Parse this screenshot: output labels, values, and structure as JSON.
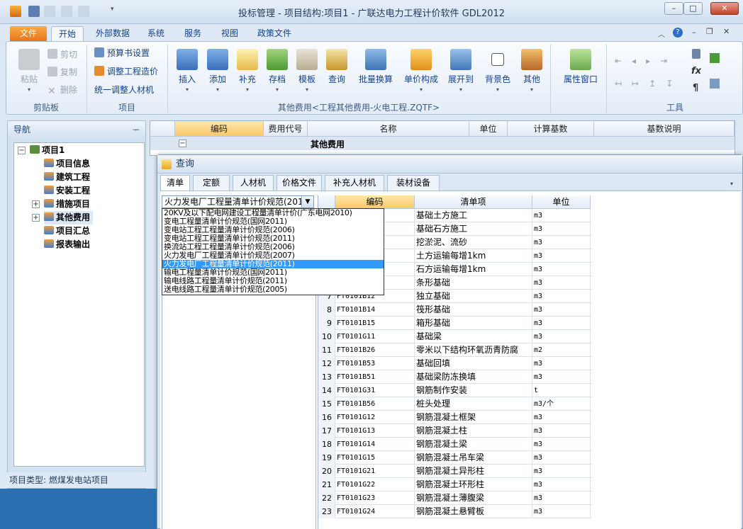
{
  "window": {
    "title": "投标管理 - 项目结构:项目1 - 广联达电力工程计价软件 GDL2012"
  },
  "menu": {
    "tabs": [
      "文件",
      "开始",
      "外部数据",
      "系统",
      "服务",
      "视图",
      "政策文件"
    ]
  },
  "ribbon": {
    "clipboard": {
      "label": "剪贴板",
      "paste": "粘贴",
      "cut": "剪切",
      "copy": "复制",
      "delete": "删除"
    },
    "project": {
      "label": "项目",
      "budget_settings": "预算书设置",
      "adjust_cost": "调整工程造价",
      "adjust_materials": "统一调整人材机"
    },
    "other_costs": {
      "label": "其他费用<工程其他费用-火电工程.ZQTF>",
      "buttons": [
        "插入",
        "添加",
        "补充",
        "存档",
        "模板",
        "查询",
        "批量换算",
        "单价构成",
        "展开到",
        "背景色",
        "其他"
      ]
    },
    "attr": {
      "window": "属性窗口"
    },
    "tools": {
      "label": "工具"
    }
  },
  "nav": {
    "title": "导航",
    "root": "项目1",
    "items": [
      "项目信息",
      "建筑工程",
      "安装工程",
      "措施项目",
      "其他费用",
      "项目汇总",
      "报表输出"
    ],
    "status": "项目类型: 燃煤发电站项目"
  },
  "main_grid": {
    "columns": [
      "编码",
      "费用代号",
      "名称",
      "单位",
      "计算基数",
      "基数说明"
    ],
    "first_row_name": "其他费用"
  },
  "query": {
    "title": "查询",
    "tabs": [
      "清单",
      "定额",
      "人材机",
      "价格文件",
      "补充人材机",
      "装材设备"
    ],
    "selected_standard": "火力发电厂工程量清单计价规范(201",
    "dropdown_options": [
      "20KV及以下配电网建设工程量清单计价(广东电网2010)",
      "变电工程量清单计价规范(国网2011)",
      "变电站工程工程量清单计价规范(2006)",
      "变电站工程工程量清单计价规范(2011)",
      "换流站工程工程量清单计价规范(2006)",
      "火力发电厂工程量清单计价规范(2007)",
      "火力发电厂工程量清单计价规范(2011)",
      "输电工程量清单计价规范(国网2011)",
      "输电线路工程量清单计价规范(2011)",
      "送电线路工程量清单计价规范(2005)"
    ],
    "highlighted_option": 6,
    "columns": [
      "编码",
      "清单项",
      "单位"
    ],
    "rows": [
      {
        "no": "",
        "code": "",
        "name": "基础土方施工",
        "unit": "m3"
      },
      {
        "no": "",
        "code": "",
        "name": "基础石方施工",
        "unit": "m3"
      },
      {
        "no": "",
        "code": "",
        "name": "挖淤泥、流砂",
        "unit": "m3"
      },
      {
        "no": "",
        "code": "",
        "name": "土方运输每增1km",
        "unit": "m3"
      },
      {
        "no": "",
        "code": "",
        "name": "石方运输每增1km",
        "unit": "m3"
      },
      {
        "no": "",
        "code": "",
        "name": "条形基础",
        "unit": "m3"
      },
      {
        "no": "7",
        "code": "FT0101B12",
        "name": "独立基础",
        "unit": "m3"
      },
      {
        "no": "8",
        "code": "FT0101B14",
        "name": "筏形基础",
        "unit": "m3"
      },
      {
        "no": "9",
        "code": "FT0101B15",
        "name": "箱形基础",
        "unit": "m3"
      },
      {
        "no": "10",
        "code": "FT0101G11",
        "name": "基础梁",
        "unit": "m3"
      },
      {
        "no": "11",
        "code": "FT0101B26",
        "name": "零米以下结构环氧沥青防腐",
        "unit": "m2"
      },
      {
        "no": "12",
        "code": "FT0101B53",
        "name": "基础回填",
        "unit": "m3"
      },
      {
        "no": "13",
        "code": "FT0101B51",
        "name": "基础梁防冻换填",
        "unit": "m3"
      },
      {
        "no": "14",
        "code": "FT0101G31",
        "name": "钢筋制作安装",
        "unit": "t"
      },
      {
        "no": "15",
        "code": "FT0101B56",
        "name": "桩头处理",
        "unit": "m3/个"
      },
      {
        "no": "16",
        "code": "FT0101G12",
        "name": "钢筋混凝土框架",
        "unit": "m3"
      },
      {
        "no": "17",
        "code": "FT0101G13",
        "name": "钢筋混凝土柱",
        "unit": "m3"
      },
      {
        "no": "18",
        "code": "FT0101G14",
        "name": "钢筋混凝土梁",
        "unit": "m3"
      },
      {
        "no": "19",
        "code": "FT0101G15",
        "name": "钢筋混凝土吊车梁",
        "unit": "m3"
      },
      {
        "no": "20",
        "code": "FT0101G21",
        "name": "钢筋混凝土异形柱",
        "unit": "m3"
      },
      {
        "no": "21",
        "code": "FT0101G22",
        "name": "钢筋混凝土环形柱",
        "unit": "m3"
      },
      {
        "no": "22",
        "code": "FT0101G23",
        "name": "钢筋混凝土薄腹梁",
        "unit": "m3"
      },
      {
        "no": "23",
        "code": "FT0101G24",
        "name": "钢筋混凝土悬臂板",
        "unit": "m3"
      }
    ]
  },
  "colors": {
    "accent": "#e8751a",
    "selection": "#3399ff",
    "header_selected": "#f8c96a"
  }
}
